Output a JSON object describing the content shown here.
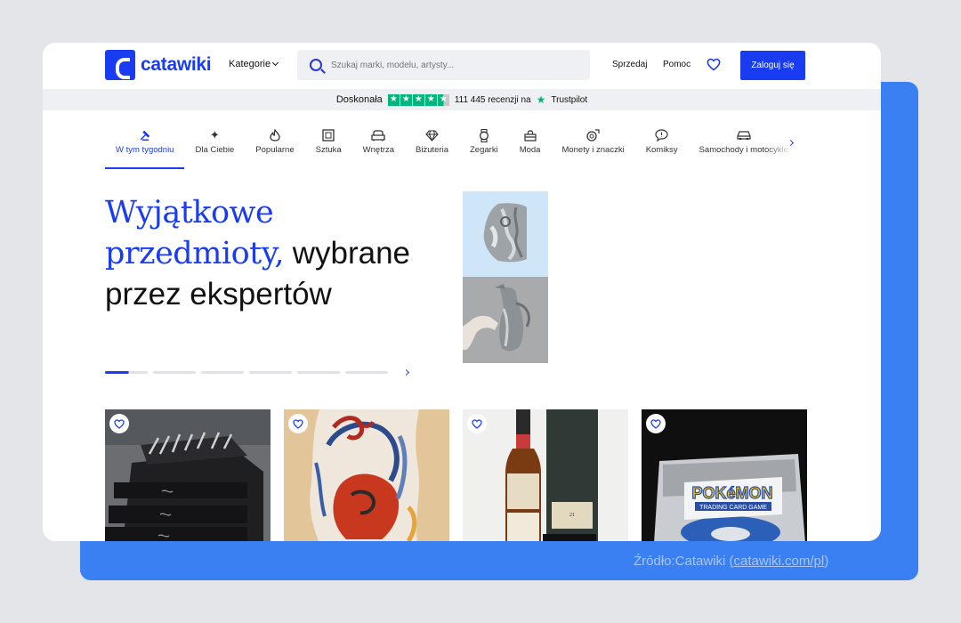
{
  "header": {
    "logo_text": "catawiki",
    "categories_label": "Kategorie",
    "search_placeholder": "Szukaj marki, modelu, artysty...",
    "sell_label": "Sprzedaj",
    "help_label": "Pomoc",
    "login_label": "Zaloguj się"
  },
  "trustbar": {
    "rating_label": "Doskonała",
    "reviews": "111 445 recenzji na",
    "brand": "Trustpilot",
    "stars": 4.5
  },
  "categories": [
    {
      "label": "W tym tygodniu",
      "icon": "gavel-icon",
      "active": true
    },
    {
      "label": "Dla Ciebie",
      "icon": "sparkle-icon"
    },
    {
      "label": "Popularne",
      "icon": "flame-icon"
    },
    {
      "label": "Sztuka",
      "icon": "frame-icon"
    },
    {
      "label": "Wnętrza",
      "icon": "sofa-icon"
    },
    {
      "label": "Biżuteria",
      "icon": "diamond-icon"
    },
    {
      "label": "Zegarki",
      "icon": "watch-icon"
    },
    {
      "label": "Moda",
      "icon": "bag-icon"
    },
    {
      "label": "Monety i znaczki",
      "icon": "coins-icon"
    },
    {
      "label": "Komiksy",
      "icon": "speech-bubble-icon"
    },
    {
      "label": "Samochody i motocykle",
      "icon": "car-icon"
    }
  ],
  "hero": {
    "title_serif": "Wyjątkowe przedmioty,",
    "title_sans_1": "wybrane",
    "title_sans_2": "przez ekspertów",
    "slides_count": 6,
    "active_slide": 1
  },
  "products": [
    {
      "name": "cutlery-chest-image"
    },
    {
      "name": "abstract-painting-image"
    },
    {
      "name": "whisky-bottle-image"
    },
    {
      "name": "pokemon-box-image"
    }
  ],
  "source": {
    "prefix": "Źródło:Catawiki (",
    "link": "catawiki.com/pl",
    "suffix": ")"
  },
  "colors": {
    "brand": "#1a3cf0",
    "panel": "#3a80f2",
    "trustpilot": "#00b67a"
  }
}
